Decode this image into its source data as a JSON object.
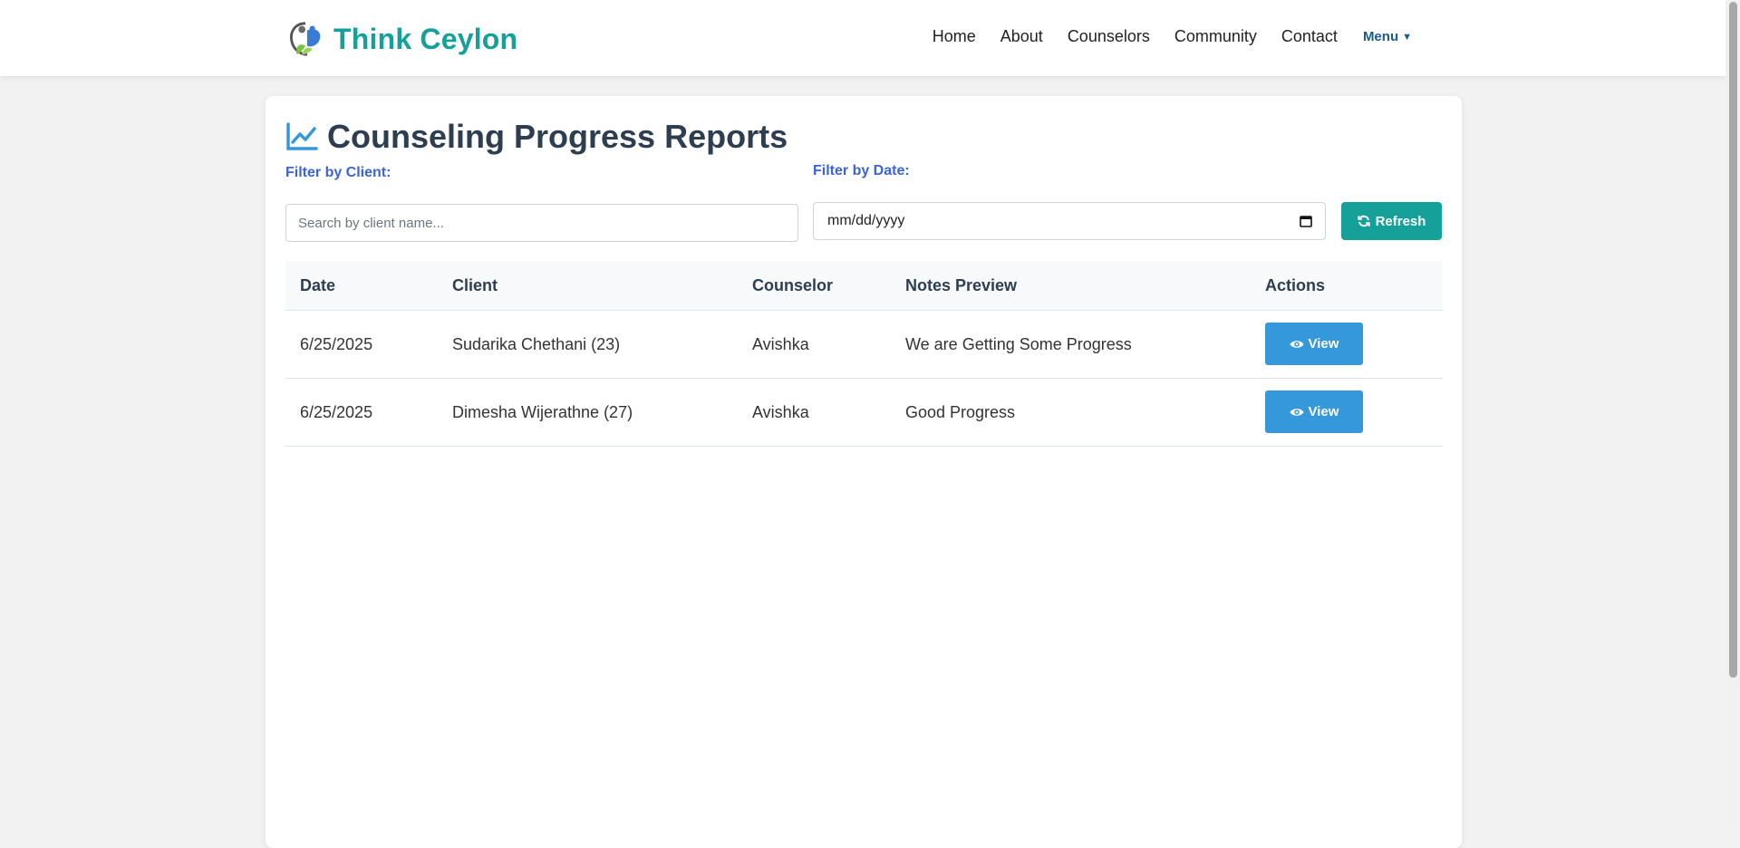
{
  "brand": {
    "name": "Think Ceylon",
    "accent_color": "#16a09a",
    "logo_icon": "leaf-person-logo"
  },
  "nav": {
    "links": [
      "Home",
      "About",
      "Counselors",
      "Community",
      "Contact"
    ],
    "menu_label": "Menu",
    "menu_icon": "caret-down-icon"
  },
  "page": {
    "title": "Counseling Progress Reports",
    "title_icon": "line-chart-icon"
  },
  "filters": {
    "client_label": "Filter by Client:",
    "client_placeholder": "Search by client name...",
    "client_value": "",
    "date_label": "Filter by Date:",
    "date_placeholder": "mm/dd/yyyy",
    "date_icon": "calendar-icon",
    "refresh_label": "Refresh",
    "refresh_icon": "sync-icon"
  },
  "table": {
    "columns": [
      "Date",
      "Client",
      "Counselor",
      "Notes Preview",
      "Actions"
    ],
    "rows": [
      {
        "date": "6/25/2025",
        "client": "Sudarika Chethani (23)",
        "counselor": "Avishka",
        "notes": "We are Getting Some Progress",
        "action_label": "View"
      },
      {
        "date": "6/25/2025",
        "client": "Dimesha Wijerathne (27)",
        "counselor": "Avishka",
        "notes": "Good Progress",
        "action_label": "View"
      }
    ],
    "action_icon": "eye-icon"
  },
  "colors": {
    "view_button": "#3498db",
    "filter_label": "#3a64d8",
    "title": "#2c3e50"
  }
}
